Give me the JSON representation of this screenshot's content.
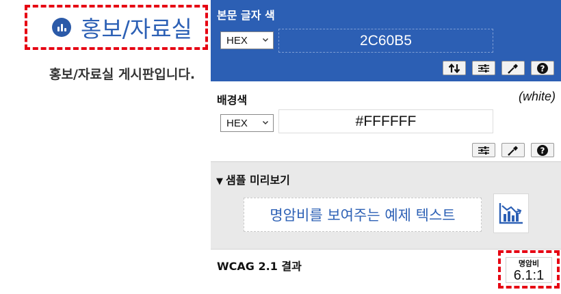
{
  "page": {
    "title": "홍보/자료실",
    "description": "홍보/자료실 게시판입니다.",
    "title_icon": "bar-chart-circle-icon"
  },
  "text_color": {
    "label": "본문 글자 색",
    "format": "HEX",
    "value": "2C60B5",
    "tools": [
      "swap-icon",
      "sliders-icon",
      "eyedropper-icon",
      "help-icon"
    ]
  },
  "background_color": {
    "label": "배경색",
    "name": "(white)",
    "format": "HEX",
    "value": "#FFFFFF",
    "tools": [
      "sliders-icon",
      "eyedropper-icon",
      "help-icon"
    ]
  },
  "preview": {
    "toggle": "▼",
    "label": "샘플 미리보기",
    "sample_text": "명암비를 보여주는 예제 텍스트",
    "graph_icon": "chart-trend-icon"
  },
  "wcag": {
    "label": "WCAG 2.1 결과",
    "ratio_caption": "명암비",
    "ratio_value": "6.1:1"
  },
  "colors": {
    "accent": "#2C60B5",
    "panel_header": "#2C5FB4",
    "highlight_border": "#E60012",
    "preview_bg": "#E9E9E9"
  }
}
